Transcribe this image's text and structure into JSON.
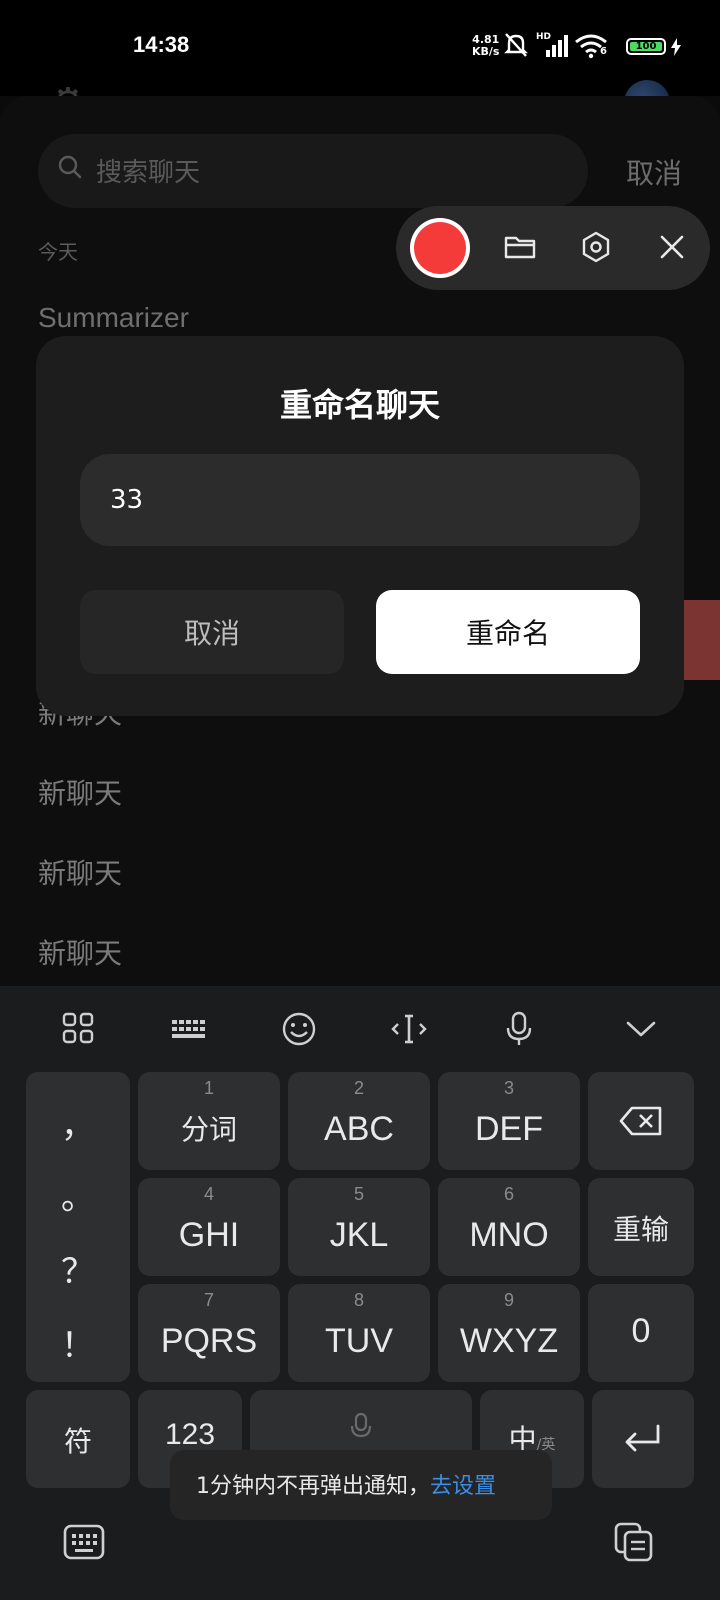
{
  "status_bar": {
    "time": "14:38",
    "net_speed_value": "4.81",
    "net_speed_unit": "KB/s",
    "signal_label": "HD",
    "wifi_label": "6",
    "battery": "100"
  },
  "search": {
    "placeholder": "搜索聊天",
    "cancel_label": "取消"
  },
  "list": {
    "section_today": "今天",
    "summarizer_title": "Summarizer",
    "items": [
      "新聊天",
      "新聊天",
      "新聊天",
      "新聊天"
    ]
  },
  "dialog": {
    "title": "重命名聊天",
    "input_value": "33",
    "cancel_label": "取消",
    "confirm_label": "重命名"
  },
  "keyboard": {
    "keys": [
      {
        "num": "1",
        "label": "分词"
      },
      {
        "num": "2",
        "label": "ABC"
      },
      {
        "num": "3",
        "label": "DEF"
      },
      {
        "num": "4",
        "label": "GHI"
      },
      {
        "num": "5",
        "label": "JKL"
      },
      {
        "num": "6",
        "label": "MNO"
      },
      {
        "num": "7",
        "label": "PQRS"
      },
      {
        "num": "8",
        "label": "TUV"
      },
      {
        "num": "9",
        "label": "WXYZ"
      }
    ],
    "punctuation": [
      "，",
      "。",
      "？",
      "！"
    ],
    "retype_label": "重输",
    "zero_label": "0",
    "symbols_label": "符",
    "num_label": "123",
    "lang_label": "中",
    "lang_sub": "/英"
  },
  "toast": {
    "text": "1分钟内不再弹出通知，",
    "link": "去设置"
  },
  "colors": {
    "accent_record": "#f53a3a",
    "link": "#3a8ee6",
    "battery_fill": "#4cd964"
  }
}
